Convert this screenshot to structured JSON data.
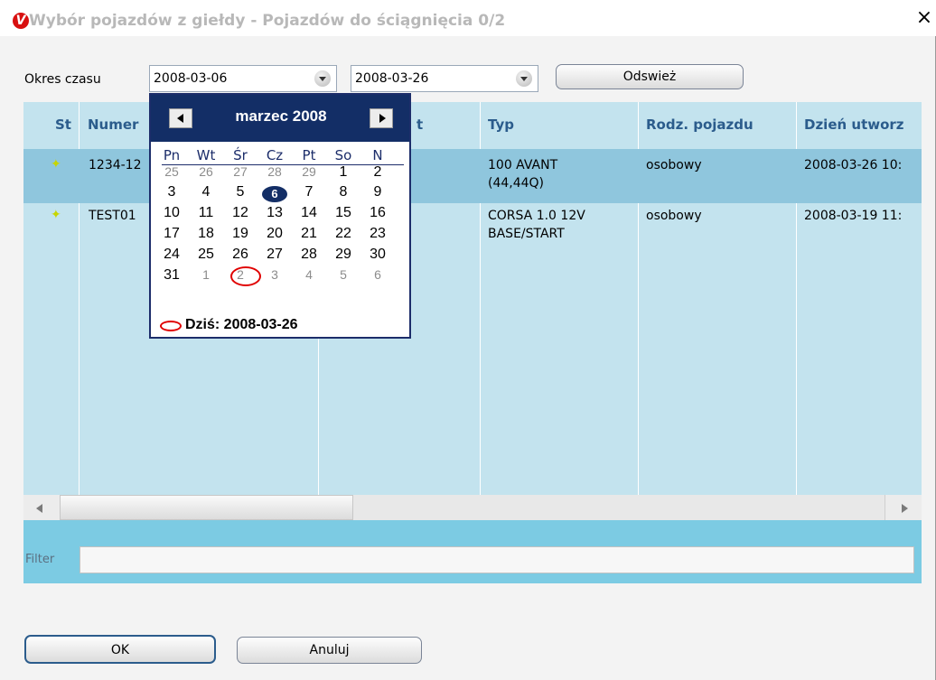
{
  "window": {
    "title": "Wybór pojazdów z giełdy - Pojazdów do ściągnięcia 0/2",
    "icon_letter": "V",
    "close_label": "x"
  },
  "toolbar": {
    "period_label": "Okres czasu",
    "date_from": "2008-03-06",
    "date_to": "2008-03-26",
    "refresh_label": "Odswież"
  },
  "grid": {
    "columns": [
      "St",
      "Numer",
      "t",
      "Typ",
      "Rodz. pojazdu",
      "Dzień utworz"
    ],
    "rows": [
      {
        "status_icon": "star-icon",
        "numer": "1234-12",
        "typ_line1": "100 AVANT",
        "typ_line2": "(44,44Q)",
        "rodzaj": "osobowy",
        "dzien": "2008-03-26 10:"
      },
      {
        "status_icon": "star-icon",
        "numer": "TEST01",
        "typ_line1": "CORSA 1.0 12V",
        "typ_line2": "BASE/START",
        "rodzaj": "osobowy",
        "dzien": "2008-03-19 11:"
      }
    ]
  },
  "filter": {
    "label": "Filter",
    "value": ""
  },
  "calendar": {
    "title": "marzec 2008",
    "prev_icon": "triangle-left-icon",
    "next_icon": "triangle-right-icon",
    "day_names": [
      "Pn",
      "Wt",
      "Śr",
      "Cz",
      "Pt",
      "So",
      "N"
    ],
    "weeks": [
      [
        "25",
        "26",
        "27",
        "28",
        "29",
        "1",
        "2"
      ],
      [
        "3",
        "4",
        "5",
        "6",
        "7",
        "8",
        "9"
      ],
      [
        "10",
        "11",
        "12",
        "13",
        "14",
        "15",
        "16"
      ],
      [
        "17",
        "18",
        "19",
        "20",
        "21",
        "22",
        "23"
      ],
      [
        "24",
        "25",
        "26",
        "27",
        "28",
        "29",
        "30"
      ],
      [
        "31",
        "1",
        "2",
        "3",
        "4",
        "5",
        "6"
      ]
    ],
    "other_month": [
      [
        true,
        true,
        true,
        true,
        true,
        false,
        false
      ],
      [
        false,
        false,
        false,
        false,
        false,
        false,
        false
      ],
      [
        false,
        false,
        false,
        false,
        false,
        false,
        false
      ],
      [
        false,
        false,
        false,
        false,
        false,
        false,
        false
      ],
      [
        false,
        false,
        false,
        false,
        false,
        false,
        false
      ],
      [
        false,
        true,
        true,
        true,
        true,
        true,
        true
      ]
    ],
    "selected_day": "6",
    "today_label": "Dziś: 2008-03-26",
    "today_day": "26"
  },
  "footer": {
    "ok_label": "OK",
    "cancel_label": "Anuluj"
  },
  "colors": {
    "grid_bg": "#c3e3ee",
    "selected_row": "#8fc6dd",
    "filter_bar": "#7ccbe3",
    "header_text": "#2b5c8c",
    "calendar_header": "#132e66",
    "today_mark": "#e00000"
  }
}
